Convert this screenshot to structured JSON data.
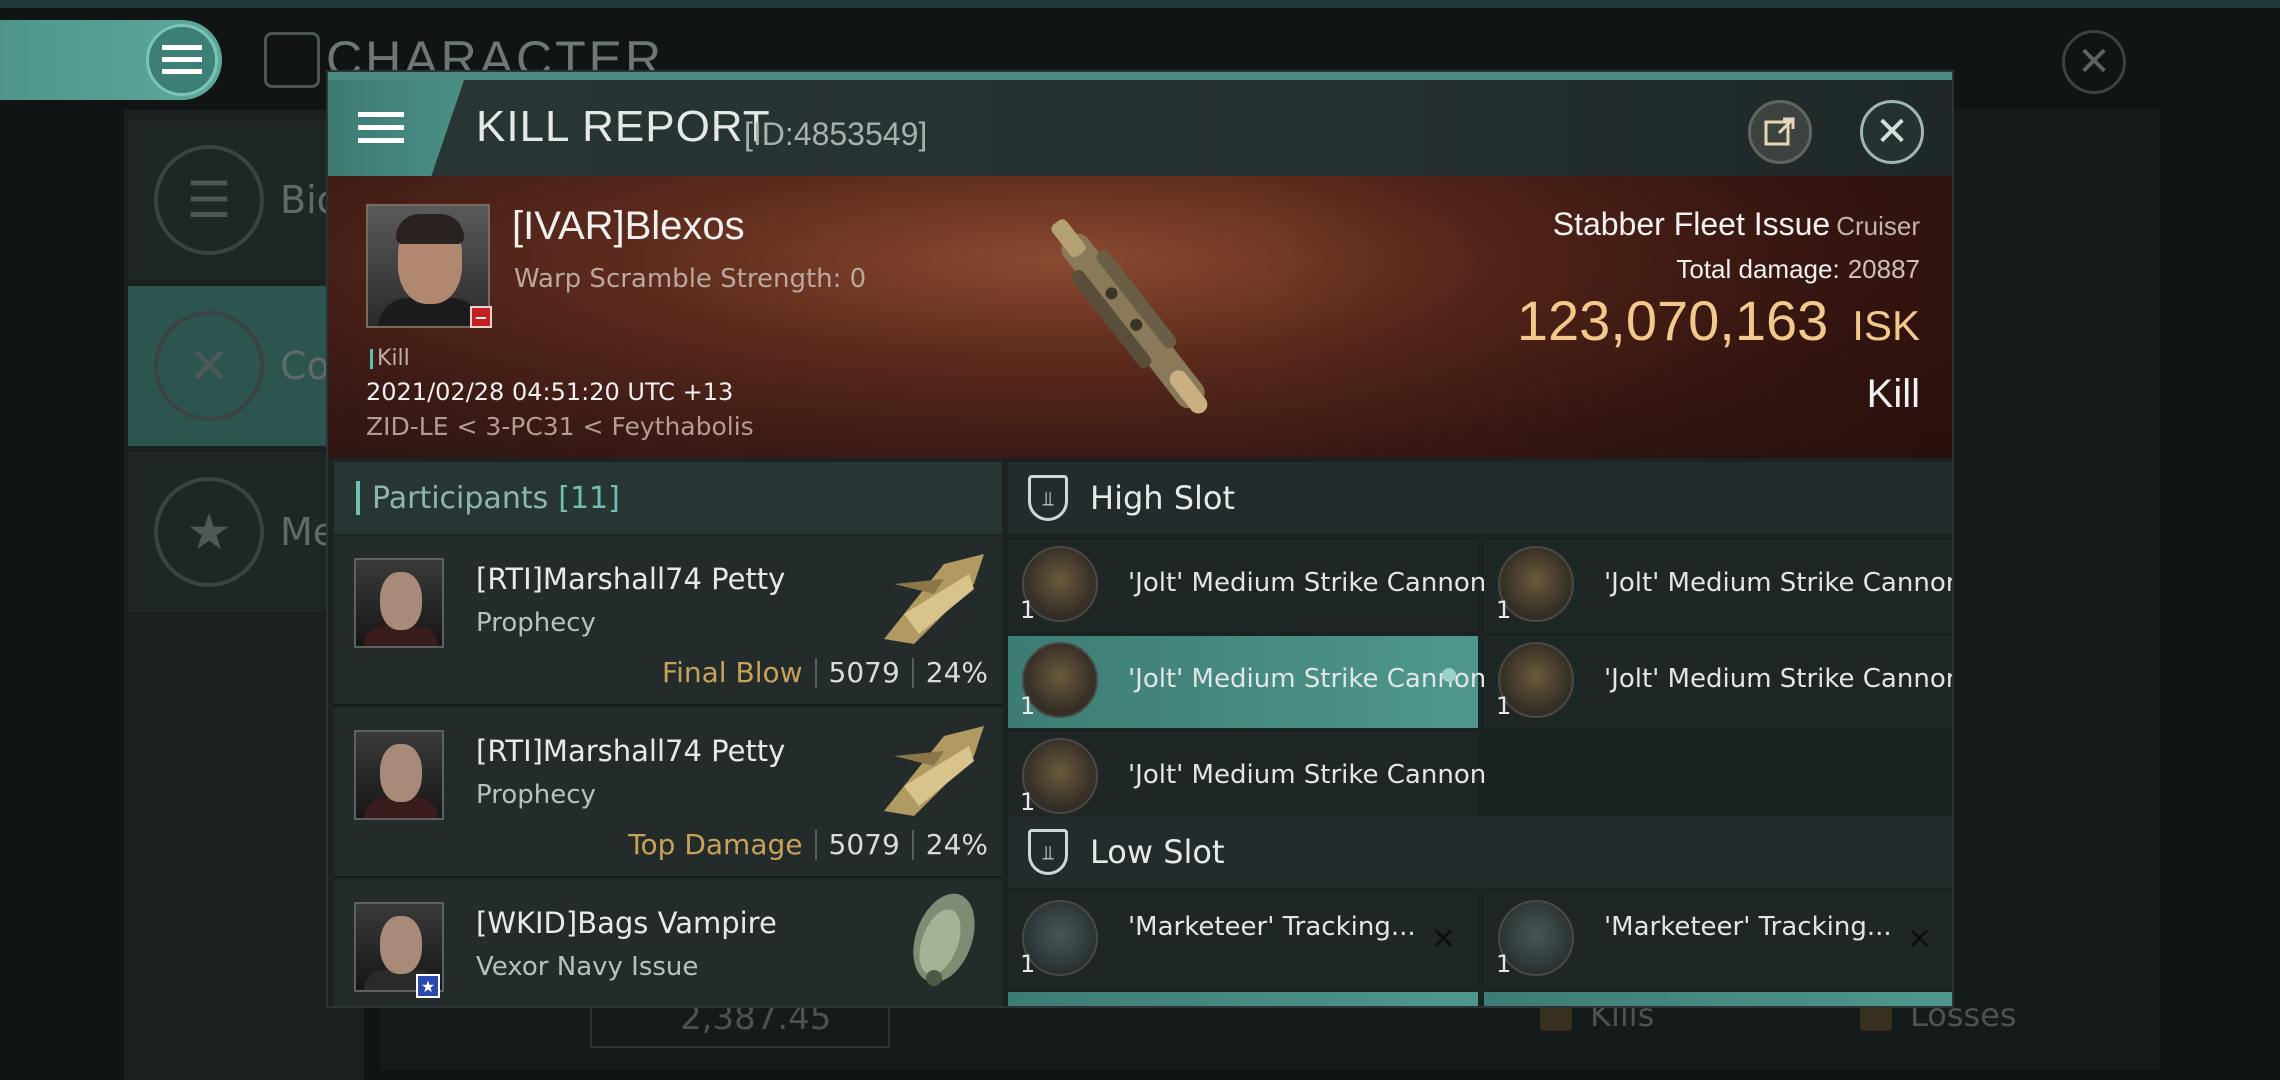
{
  "background": {
    "title": "CHARACTER",
    "side_items": [
      {
        "label": "Bio"
      },
      {
        "label": "Co"
      },
      {
        "label": "Me"
      }
    ],
    "stat_value": "2,387.45",
    "kills_label": "Kills",
    "losses_label": "Losses"
  },
  "report": {
    "title": "KILL REPORT",
    "id": "[ID:4853549]"
  },
  "victim": {
    "name": "[IVAR]Blexos",
    "scramble": "Warp Scramble Strength: 0",
    "tag": "Kill",
    "date": "2021/02/28 04:51:20 UTC +13",
    "location": "ZID-LE < 3-PC31 < Feythabolis",
    "ship": "Stabber Fleet Issue",
    "ship_class": "Cruiser",
    "damage_label": "Total damage:",
    "damage_value": "20887",
    "isk_value": "123,070,163",
    "isk_unit": "ISK",
    "result": "Kill"
  },
  "participants": {
    "label": "Participants",
    "count": "[11]",
    "rows": [
      {
        "name": "[RTI]Marshall74 Petty",
        "ship": "Prophecy",
        "tag": "Final Blow",
        "damage": "5079",
        "percent": "24%"
      },
      {
        "name": "[RTI]Marshall74 Petty",
        "ship": "Prophecy",
        "tag": "Top Damage",
        "damage": "5079",
        "percent": "24%"
      },
      {
        "name": "[WKID]Bags Vampire",
        "ship": "Vexor Navy Issue",
        "tag": "",
        "damage": "",
        "percent": ""
      }
    ]
  },
  "slots": {
    "high": {
      "label": "High Slot",
      "modules": [
        {
          "name": "'Jolt' Medium Strike Cannon",
          "qty": "1"
        },
        {
          "name": "'Jolt' Medium Strike Cannon",
          "qty": "1"
        },
        {
          "name": "'Jolt' Medium Strike Cannon",
          "qty": "1"
        },
        {
          "name": "'Jolt' Medium Strike Cannon",
          "qty": "1"
        },
        {
          "name": "'Jolt' Medium Strike Cannon",
          "qty": "1"
        }
      ]
    },
    "low": {
      "label": "Low Slot",
      "modules": [
        {
          "name": "'Marketeer' Tracking...",
          "qty": "1"
        },
        {
          "name": "'Marketeer' Tracking...",
          "qty": "1"
        }
      ]
    }
  },
  "colors": {
    "accent": "#4f978d",
    "isk": "#f2c98a",
    "tag": "#c9a25a"
  }
}
